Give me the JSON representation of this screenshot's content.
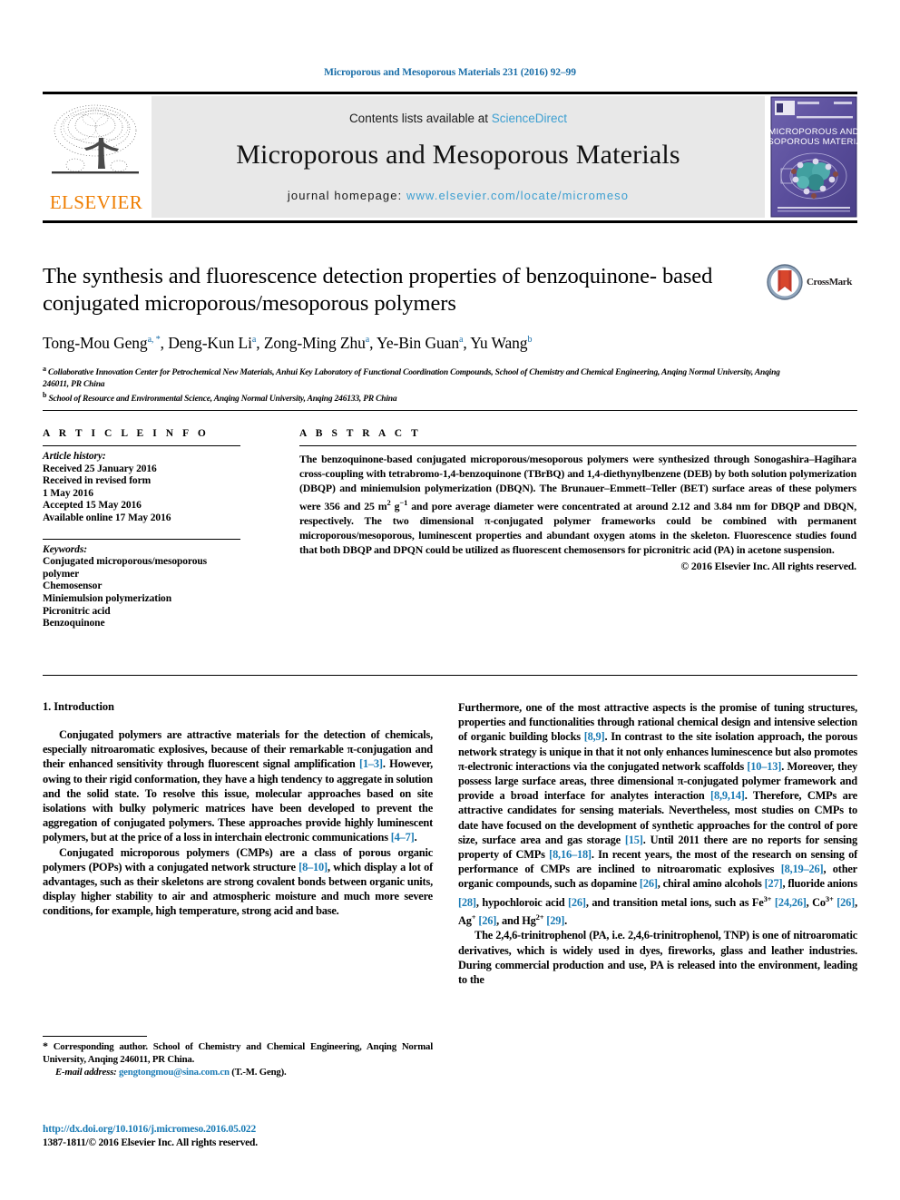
{
  "running_head": "Microporous and Mesoporous Materials 231 (2016) 92–99",
  "masthead": {
    "elsevier_wordmark": "ELSEVIER",
    "contents_prefix": "Contents lists available at ",
    "contents_link": "ScienceDirect",
    "journal_title": "Microporous and Mesoporous Materials",
    "homepage_prefix": "journal homepage: ",
    "homepage_url": "www.elsevier.com/locate/micromeso",
    "cover_title_line1": "MICROPOROUS AND",
    "cover_title_line2": "MESOPOROUS MATERIALS"
  },
  "title": {
    "line1": "The synthesis and fluorescence detection properties of benzoquinone-",
    "line2": "based conjugated microporous/mesoporous polymers"
  },
  "crossmark": {
    "label": "CrossMark"
  },
  "authors": [
    {
      "name": "Tong-Mou Geng",
      "marks": "a, *"
    },
    {
      "name": "Deng-Kun Li",
      "marks": "a"
    },
    {
      "name": "Zong-Ming Zhu",
      "marks": "a"
    },
    {
      "name": "Ye-Bin Guan",
      "marks": "a"
    },
    {
      "name": "Yu Wang",
      "marks": "b"
    }
  ],
  "affiliations": [
    {
      "mark": "a",
      "text": "Collaborative Innovation Center for Petrochemical New Materials, Anhui Key Laboratory of Functional Coordination Compounds, School of Chemistry and Chemical Engineering, Anqing Normal University, Anqing 246011, PR China"
    },
    {
      "mark": "b",
      "text": "School of Resource and Environmental Science, Anqing Normal University, Anqing 246133, PR China"
    }
  ],
  "article_info": {
    "heading": "A R T I C L E  I N F O",
    "history_label": "Article history:",
    "history": [
      "Received 25 January 2016",
      "Received in revised form",
      "1 May 2016",
      "Accepted 15 May 2016",
      "Available online 17 May 2016"
    ],
    "keywords_label": "Keywords:",
    "keywords": [
      "Conjugated microporous/mesoporous",
      "polymer",
      "Chemosensor",
      "Miniemulsion polymerization",
      "Picronitric acid",
      "Benzoquinone"
    ]
  },
  "abstract": {
    "heading": "A B S T R A C T",
    "text_part1": "The benzoquinone-based conjugated microporous/mesoporous polymers were synthesized through Sonogashira–Hagihara cross-coupling with tetrabromo-1,4-benzoquinone (TBrBQ) and 1,4-diethynylbenzene (DEB) by both solution polymerization (DBQP) and miniemulsion polymerization (DBQN). The Brunauer–Emmett–Teller (BET) surface areas of these polymers were 356 and 25 m",
    "sup1": "2",
    "text_mid": " g",
    "sup2": "−1",
    "text_part2": " and pore average diameter were concentrated at around 2.12 and 3.84 nm for DBQP and DBQN, respectively. The two dimensional π-conjugated polymer frameworks could be combined with permanent microporous/mesoporous, luminescent properties and abundant oxygen atoms in the skeleton. Fluorescence studies found that both DBQP and DPQN could be utilized as fluorescent chemosensors for picronitric acid (PA) in acetone suspension.",
    "copyright": "© 2016 Elsevier Inc. All rights reserved."
  },
  "body": {
    "section_heading": "1. Introduction",
    "left_p1_a": "Conjugated polymers are attractive materials for the detection of chemicals, especially nitroaromatic explosives, because of their remarkable π-conjugation and their enhanced sensitivity through fluorescent signal amplification ",
    "left_p1_ref1": "[1–3]",
    "left_p1_b": ". However, owing to their rigid conformation, they have a high tendency to aggregate in solution and the solid state. To resolve this issue, molecular approaches based on site isolations with bulky polymeric matrices have been developed to prevent the aggregation of conjugated polymers. These approaches provide highly luminescent polymers, but at the price of a loss in interchain electronic communications ",
    "left_p1_ref2": "[4–7]",
    "left_p1_c": ".",
    "left_p2_a": "Conjugated microporous polymers (CMPs) are a class of porous organic polymers (POPs) with a conjugated network structure ",
    "left_p2_ref1": "[8–10]",
    "left_p2_b": ", which display a lot of advantages, such as their skeletons are strong covalent bonds between organic units, display higher stability to air and atmospheric moisture and much more severe conditions, for example, high temperature, strong acid and base.",
    "right_p1_a": "Furthermore, one of the most attractive aspects is the promise of tuning structures, properties and functionalities through rational chemical design and intensive selection of organic building blocks ",
    "right_p1_ref1": "[8,9]",
    "right_p1_b": ". In contrast to the site isolation approach, the porous network strategy is unique in that it not only enhances luminescence but also promotes π-electronic interactions via the conjugated network scaffolds ",
    "right_p1_ref2": "[10–13]",
    "right_p1_c": ". Moreover, they possess large surface areas, three dimensional π-conjugated polymer framework and provide a broad interface for analytes interaction ",
    "right_p1_ref3": "[8,9,14]",
    "right_p1_d": ". Therefore, CMPs are attractive candidates for sensing materials. Nevertheless, most studies on CMPs to date have focused on the development of synthetic approaches for the control of pore size, surface area and gas storage ",
    "right_p1_ref4": "[15]",
    "right_p1_e": ". Until 2011 there are no reports for sensing property of CMPs ",
    "right_p1_ref5": "[8,16–18]",
    "right_p1_f": ". In recent years, the most of the research on sensing of performance of CMPs are inclined to nitroaromatic explosives ",
    "right_p1_ref6": "[8,19–26]",
    "right_p1_g": ", other organic compounds, such as dopamine ",
    "right_p1_ref7": "[26]",
    "right_p1_h": ", chiral amino alcohols ",
    "right_p1_ref8": "[27]",
    "right_p1_i": ", fluoride anions ",
    "right_p1_ref9": "[28]",
    "right_p1_j": ", hypochloroic acid ",
    "right_p1_ref10": "[26]",
    "right_p1_k": ", and transition metal ions, such as Fe",
    "right_p1_sup1": "3+",
    "right_p1_ref11": "[24,26]",
    "right_p1_l": ", Co",
    "right_p1_sup2": "3+",
    "right_p1_ref12": "[26]",
    "right_p1_m": ", Ag",
    "right_p1_sup3": "+",
    "right_p1_ref13": "[26]",
    "right_p1_n": ", and Hg",
    "right_p1_sup4": "2+",
    "right_p1_ref14": "[29]",
    "right_p1_o": ".",
    "right_p2": "The 2,4,6-trinitrophenol (PA, i.e. 2,4,6-trinitrophenol, TNP) is one of nitroaromatic derivatives, which is widely used in dyes, fireworks, glass and leather industries. During commercial production and use, PA is released into the environment, leading to the"
  },
  "footnote": {
    "star": "*",
    "text": " Corresponding author. School of Chemistry and Chemical Engineering, Anqing Normal University, Anqing 246011, PR China.",
    "email_label": "E-mail address:",
    "email": "gengtongmou@sina.com.cn",
    "email_suffix": " (T.-M. Geng)."
  },
  "bottom": {
    "doi": "http://dx.doi.org/10.1016/j.micromeso.2016.05.022",
    "issn": "1387-1811/© 2016 Elsevier Inc. All rights reserved."
  },
  "colors": {
    "link_blue": "#1a7bb5",
    "light_blue": "#3d9fd1",
    "elsevier_orange": "#ef7d00",
    "cover_purple": "#5b4a9e"
  }
}
